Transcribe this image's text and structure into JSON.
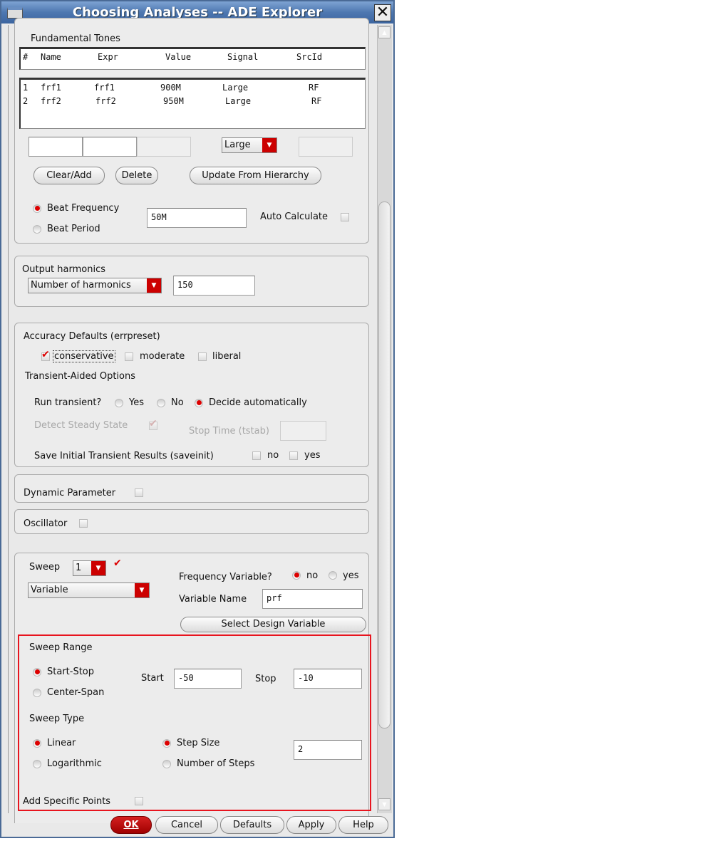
{
  "window": {
    "title": "Choosing Analyses -- ADE Explorer",
    "close": "✕"
  },
  "tones": {
    "label": "Fundamental Tones",
    "headers": [
      "#",
      "Name",
      "Expr",
      "Value",
      "Signal",
      "SrcId"
    ],
    "rows": [
      [
        "1",
        "frf1",
        "frf1",
        "900M",
        "Large",
        "RF"
      ],
      [
        "2",
        "frf2",
        "frf2",
        "950M",
        "Large",
        "RF"
      ]
    ],
    "signal_select": "Large",
    "clear_add": "Clear/Add",
    "delete": "Delete",
    "update": "Update From Hierarchy",
    "beat_freq": "Beat Frequency",
    "beat_period": "Beat Period",
    "beat_value": "50M",
    "auto_calc": "Auto Calculate"
  },
  "harmonics": {
    "label": "Output harmonics",
    "select": "Number of harmonics",
    "value": "150"
  },
  "accuracy": {
    "label": "Accuracy Defaults (errpreset)",
    "conservative": "conservative",
    "moderate": "moderate",
    "liberal": "liberal",
    "transient_label": "Transient-Aided Options",
    "run_transient": "Run transient?",
    "yes": "Yes",
    "no": "No",
    "auto": "Decide automatically",
    "detect": "Detect Steady State",
    "stop_time": "Stop Time (tstab)",
    "save_init": "Save Initial Transient Results (saveinit)",
    "save_no": "no",
    "save_yes": "yes"
  },
  "dynamic": {
    "label": "Dynamic Parameter"
  },
  "oscillator": {
    "label": "Oscillator"
  },
  "sweep": {
    "label": "Sweep",
    "count": "1",
    "type_select": "Variable",
    "freq_var": "Frequency Variable?",
    "fv_no": "no",
    "fv_yes": "yes",
    "var_name_label": "Variable Name",
    "var_name": "prf",
    "select_design": "Select Design Variable",
    "range_label": "Sweep Range",
    "start_stop": "Start-Stop",
    "center_span": "Center-Span",
    "start_label": "Start",
    "start": "-50",
    "stop_label": "Stop",
    "stop": "-10",
    "type_label": "Sweep Type",
    "linear": "Linear",
    "log": "Logarithmic",
    "step_size": "Step Size",
    "num_steps": "Number of Steps",
    "step_value": "2",
    "add_points": "Add Specific Points"
  },
  "footer": {
    "ok": "OK",
    "cancel": "Cancel",
    "defaults": "Defaults",
    "apply": "Apply",
    "help": "Help"
  },
  "colors": {
    "accent": "#cc0000",
    "highlight": "#e8141e"
  }
}
